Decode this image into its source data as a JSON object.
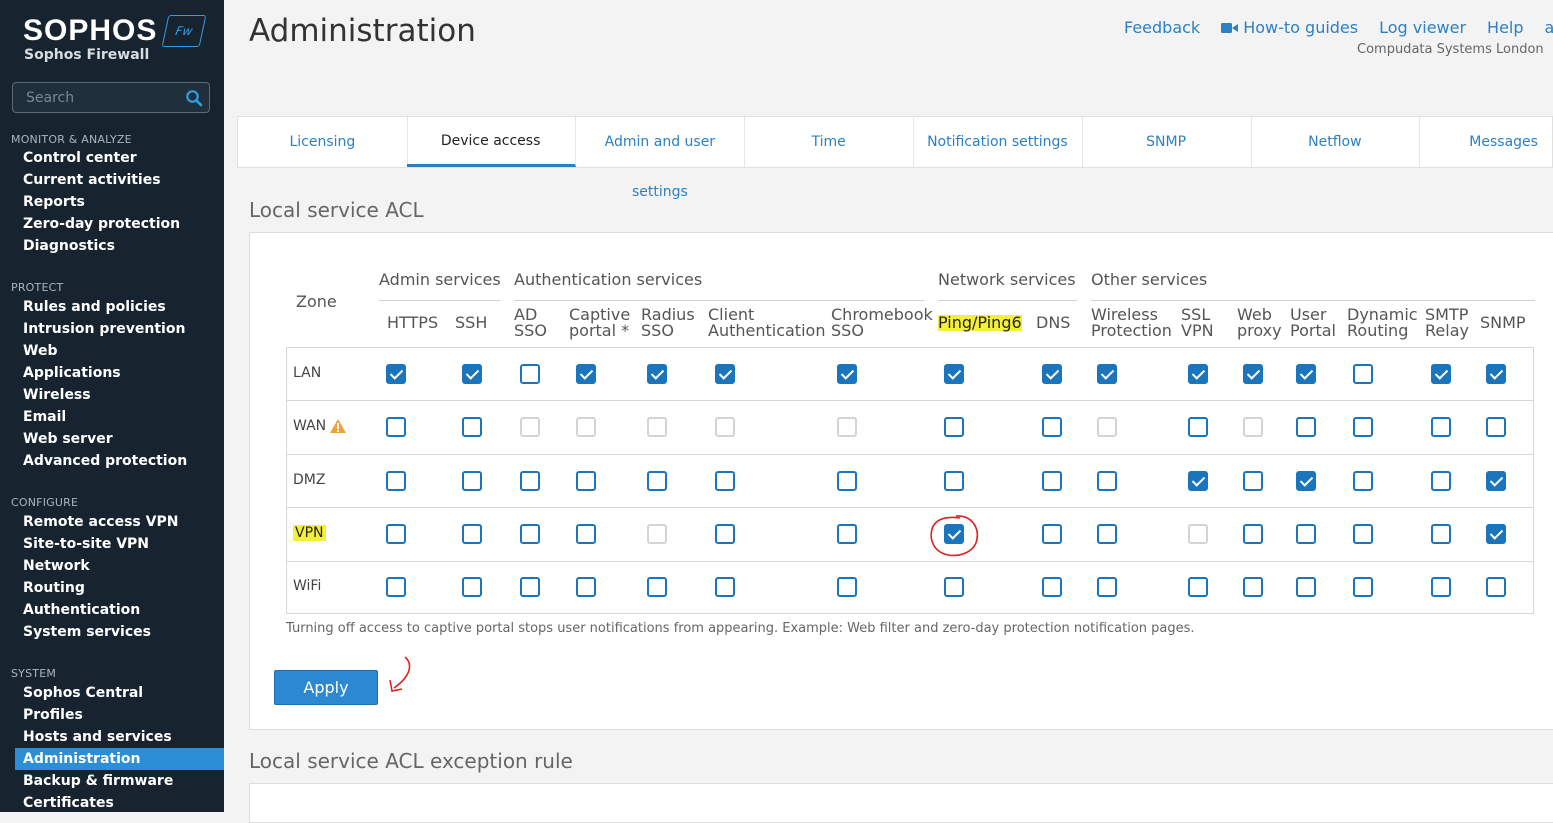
{
  "brand": {
    "name": "SOPHOS",
    "badge": "Fw",
    "product": "Sophos Firewall"
  },
  "search": {
    "placeholder": "Search"
  },
  "sidebar": {
    "sections": [
      {
        "title": "MONITOR & ANALYZE",
        "items": [
          "Control center",
          "Current activities",
          "Reports",
          "Zero-day protection",
          "Diagnostics"
        ]
      },
      {
        "title": "PROTECT",
        "items": [
          "Rules and policies",
          "Intrusion prevention",
          "Web",
          "Applications",
          "Wireless",
          "Email",
          "Web server",
          "Advanced protection"
        ]
      },
      {
        "title": "CONFIGURE",
        "items": [
          "Remote access VPN",
          "Site-to-site VPN",
          "Network",
          "Routing",
          "Authentication",
          "System services"
        ]
      },
      {
        "title": "SYSTEM",
        "items": [
          "Sophos Central",
          "Profiles",
          "Hosts and services",
          "Administration",
          "Backup & firmware",
          "Certificates"
        ]
      }
    ],
    "active": "Administration"
  },
  "header": {
    "title": "Administration",
    "links": [
      "Feedback",
      "How-to guides",
      "Log viewer",
      "Help",
      "adm"
    ],
    "company": "Compudata Systems London"
  },
  "tabs": [
    "Licensing",
    "Device access",
    "Admin and user settings",
    "Time",
    "Notification settings",
    "SNMP",
    "Netflow",
    "Messages"
  ],
  "active_tab": "Device access",
  "acl": {
    "title": "Local service ACL",
    "zone_header": "Zone",
    "groups": [
      "Admin services",
      "Authentication services",
      "Network services",
      "Other services"
    ],
    "columns": [
      [
        "HTTPS"
      ],
      [
        "SSH"
      ],
      [
        "AD",
        "SSO"
      ],
      [
        "Captive",
        "portal *"
      ],
      [
        "Radius",
        "SSO"
      ],
      [
        "Client",
        "Authentication"
      ],
      [
        "Chromebook",
        "SSO"
      ],
      [
        "Ping/Ping6"
      ],
      [
        "DNS"
      ],
      [
        "Wireless",
        "Protection"
      ],
      [
        "SSL",
        "VPN"
      ],
      [
        "Web",
        "proxy"
      ],
      [
        "User",
        "Portal"
      ],
      [
        "Dynamic",
        "Routing"
      ],
      [
        "SMTP",
        "Relay"
      ],
      [
        "SNMP"
      ]
    ],
    "rows": [
      {
        "zone": "LAN",
        "states": [
          "on",
          "on",
          "off",
          "on",
          "on",
          "on",
          "on",
          "on",
          "on",
          "on",
          "on",
          "on",
          "on",
          "off",
          "on",
          "on"
        ]
      },
      {
        "zone": "WAN",
        "warning": true,
        "states": [
          "off",
          "off",
          "dis",
          "dis",
          "dis",
          "dis",
          "dis",
          "off",
          "off",
          "dis",
          "off",
          "dis",
          "off",
          "off",
          "off",
          "off"
        ]
      },
      {
        "zone": "DMZ",
        "states": [
          "off",
          "off",
          "off",
          "off",
          "off",
          "off",
          "off",
          "off",
          "off",
          "off",
          "on",
          "off",
          "on",
          "off",
          "off",
          "on"
        ]
      },
      {
        "zone": "VPN",
        "highlight": true,
        "states": [
          "off",
          "off",
          "off",
          "off",
          "dis",
          "off",
          "off",
          "on",
          "off",
          "off",
          "dis",
          "off",
          "off",
          "off",
          "off",
          "on"
        ]
      },
      {
        "zone": "WiFi",
        "states": [
          "off",
          "off",
          "off",
          "off",
          "off",
          "off",
          "off",
          "off",
          "off",
          "off",
          "off",
          "off",
          "off",
          "off",
          "off",
          "off"
        ]
      }
    ],
    "note": "Turning off access to captive portal stops user notifications from appearing. Example: Web filter and zero-day protection notification pages.",
    "apply_label": "Apply"
  },
  "exception": {
    "title": "Local service ACL exception rule"
  },
  "colors": {
    "accent": "#2c89d1",
    "sidebar": "#17242f",
    "highlight": "#f4f03a",
    "annotation": "#e02020"
  }
}
